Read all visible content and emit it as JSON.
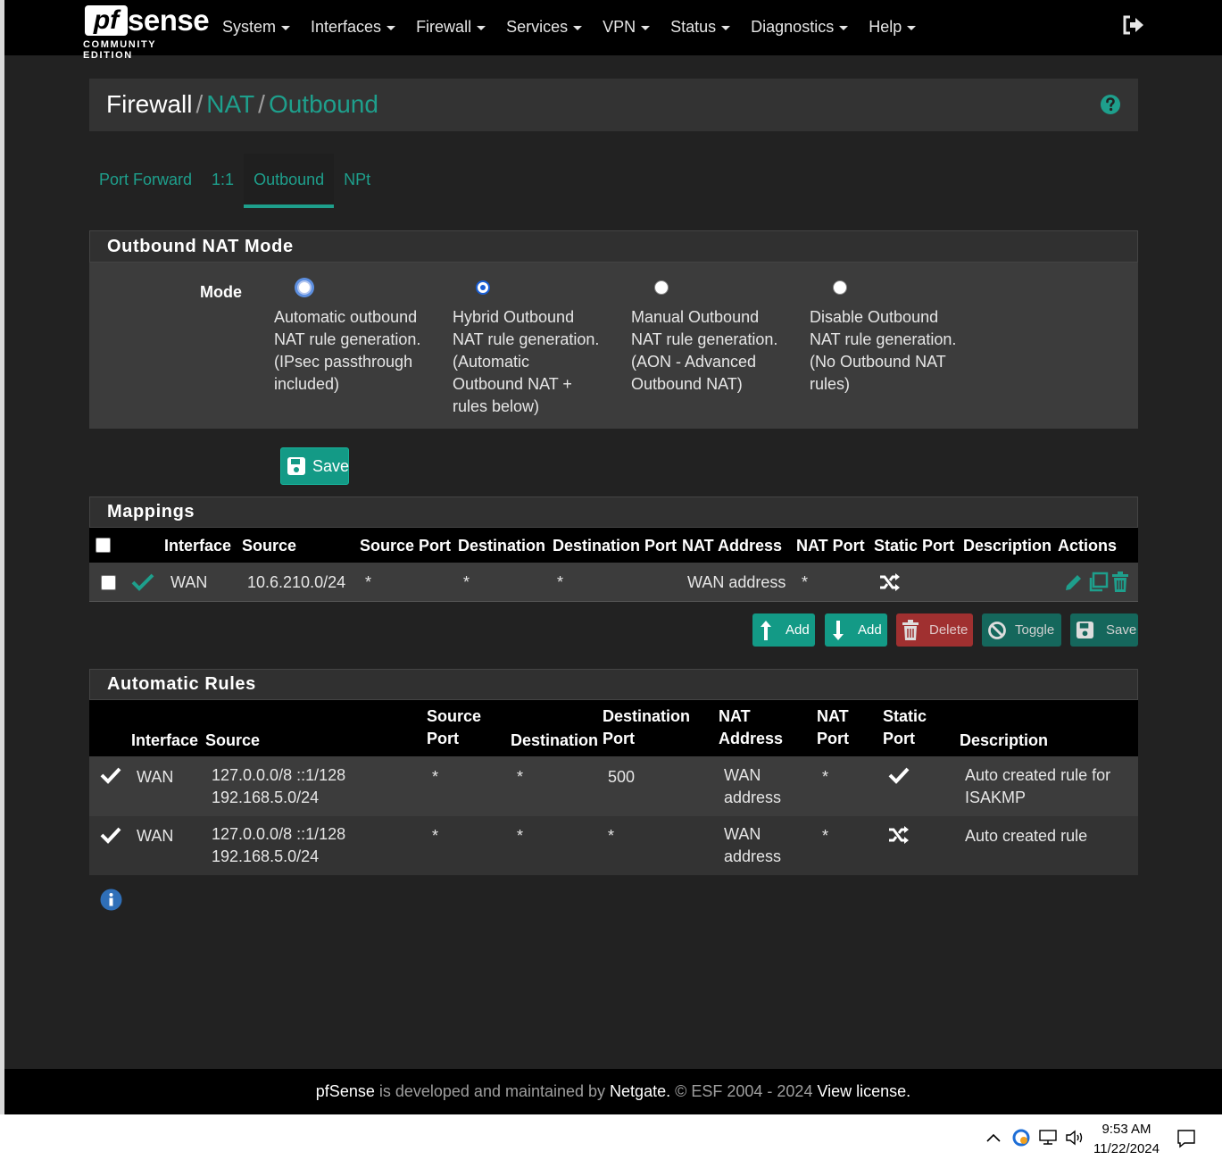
{
  "brand": {
    "logo_pf": "pf",
    "logo_sense": "sense",
    "edition": "COMMUNITY EDITION"
  },
  "nav": [
    "System",
    "Interfaces",
    "Firewall",
    "Services",
    "VPN",
    "Status",
    "Diagnostics",
    "Help"
  ],
  "breadcrumb": {
    "first": "Firewall",
    "second": "NAT",
    "third": "Outbound",
    "sep": "/"
  },
  "tabs": [
    "Port Forward",
    "1:1",
    "Outbound",
    "NPt"
  ],
  "mode_panel": {
    "title": "Outbound NAT Mode",
    "label": "Mode",
    "options": [
      "Automatic outbound NAT rule generation. (IPsec passthrough included)",
      "Hybrid Outbound NAT rule generation. (Automatic Outbound NAT + rules below)",
      "Manual Outbound NAT rule generation. (AON - Advanced Outbound NAT)",
      "Disable Outbound NAT rule generation. (No Outbound NAT rules)"
    ],
    "selected": "Hybrid Outbound NAT rule generation. (Automatic Outbound NAT + rules below)",
    "save_label": "Save"
  },
  "mappings": {
    "title": "Mappings",
    "headers": [
      "Interface",
      "Source",
      "Source Port",
      "Destination",
      "Destination Port",
      "NAT Address",
      "NAT Port",
      "Static Port",
      "Description",
      "Actions"
    ],
    "rows": [
      {
        "interface": "WAN",
        "source": "10.6.210.0/24",
        "source_port": "*",
        "destination": "*",
        "destination_port": "*",
        "nat_address": "WAN address",
        "nat_port": "*",
        "static_port_icon": "shuffle-icon",
        "description": ""
      }
    ],
    "buttons": {
      "add_top": "Add",
      "add_bottom": "Add",
      "delete": "Delete",
      "toggle": "Toggle",
      "save": "Save"
    }
  },
  "automatic": {
    "title": "Automatic Rules",
    "headers": {
      "interface": "Interface",
      "source": "Source",
      "source_port": "Source Port",
      "destination": "Destination",
      "destination_port": "Destination Port",
      "nat_address": "NAT Address",
      "nat_port": "NAT Port",
      "static_port": "Static Port",
      "description": "Description"
    },
    "rows": [
      {
        "interface": "WAN",
        "source": "127.0.0.0/8 ::1/128 192.168.5.0/24",
        "source_port": "*",
        "destination": "*",
        "destination_port": "500",
        "nat_address": "WAN address",
        "nat_port": "*",
        "static_port_icon": "check-icon",
        "description": "Auto created rule for ISAKMP"
      },
      {
        "interface": "WAN",
        "source": "127.0.0.0/8 ::1/128 192.168.5.0/24",
        "source_port": "*",
        "destination": "*",
        "destination_port": "*",
        "nat_address": "WAN address",
        "nat_port": "*",
        "static_port_icon": "shuffle-icon",
        "description": "Auto created rule"
      }
    ]
  },
  "footer": {
    "brand": "pfSense",
    "text1": " is developed and maintained by ",
    "netgate": "Netgate.",
    "text2": " © ESF 2004 - 2024 ",
    "license": "View license."
  },
  "taskbar": {
    "time": "9:53 AM",
    "date": "11/22/2024"
  },
  "colors": {
    "accent": "#1e9f8c",
    "danger": "#a33",
    "panel": "#3c3c3c",
    "background": "#222222"
  }
}
